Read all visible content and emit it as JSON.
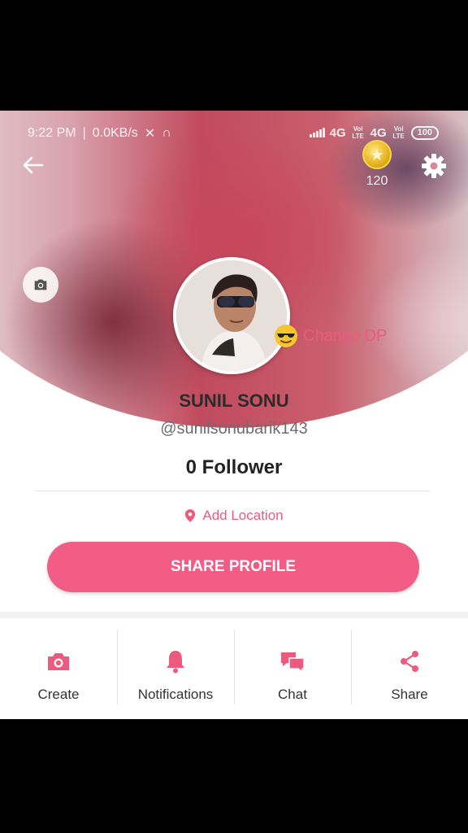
{
  "status_bar": {
    "time": "9:22 PM",
    "speed": "0.0KB/s",
    "network_1": "4G",
    "lte_1": "Vol LTE",
    "network_2": "4G",
    "lte_2": "Vol LTE",
    "battery": "100"
  },
  "header": {
    "coins": "120"
  },
  "profile": {
    "change_dp_label": "Change DP",
    "name": "SUNIL SONU",
    "handle": "@sunilsonubarik143",
    "followers": "0 Follower",
    "location_label": "Add Location",
    "share_button": "SHARE PROFILE"
  },
  "bottom_nav": {
    "items": [
      {
        "label": "Create",
        "icon": "camera-icon"
      },
      {
        "label": "Notifications",
        "icon": "bell-icon"
      },
      {
        "label": "Chat",
        "icon": "chat-bubbles-icon"
      },
      {
        "label": "Share",
        "icon": "share-icon"
      }
    ]
  },
  "colors": {
    "accent": "#f25d86",
    "accent_text": "#ec5b7d"
  }
}
